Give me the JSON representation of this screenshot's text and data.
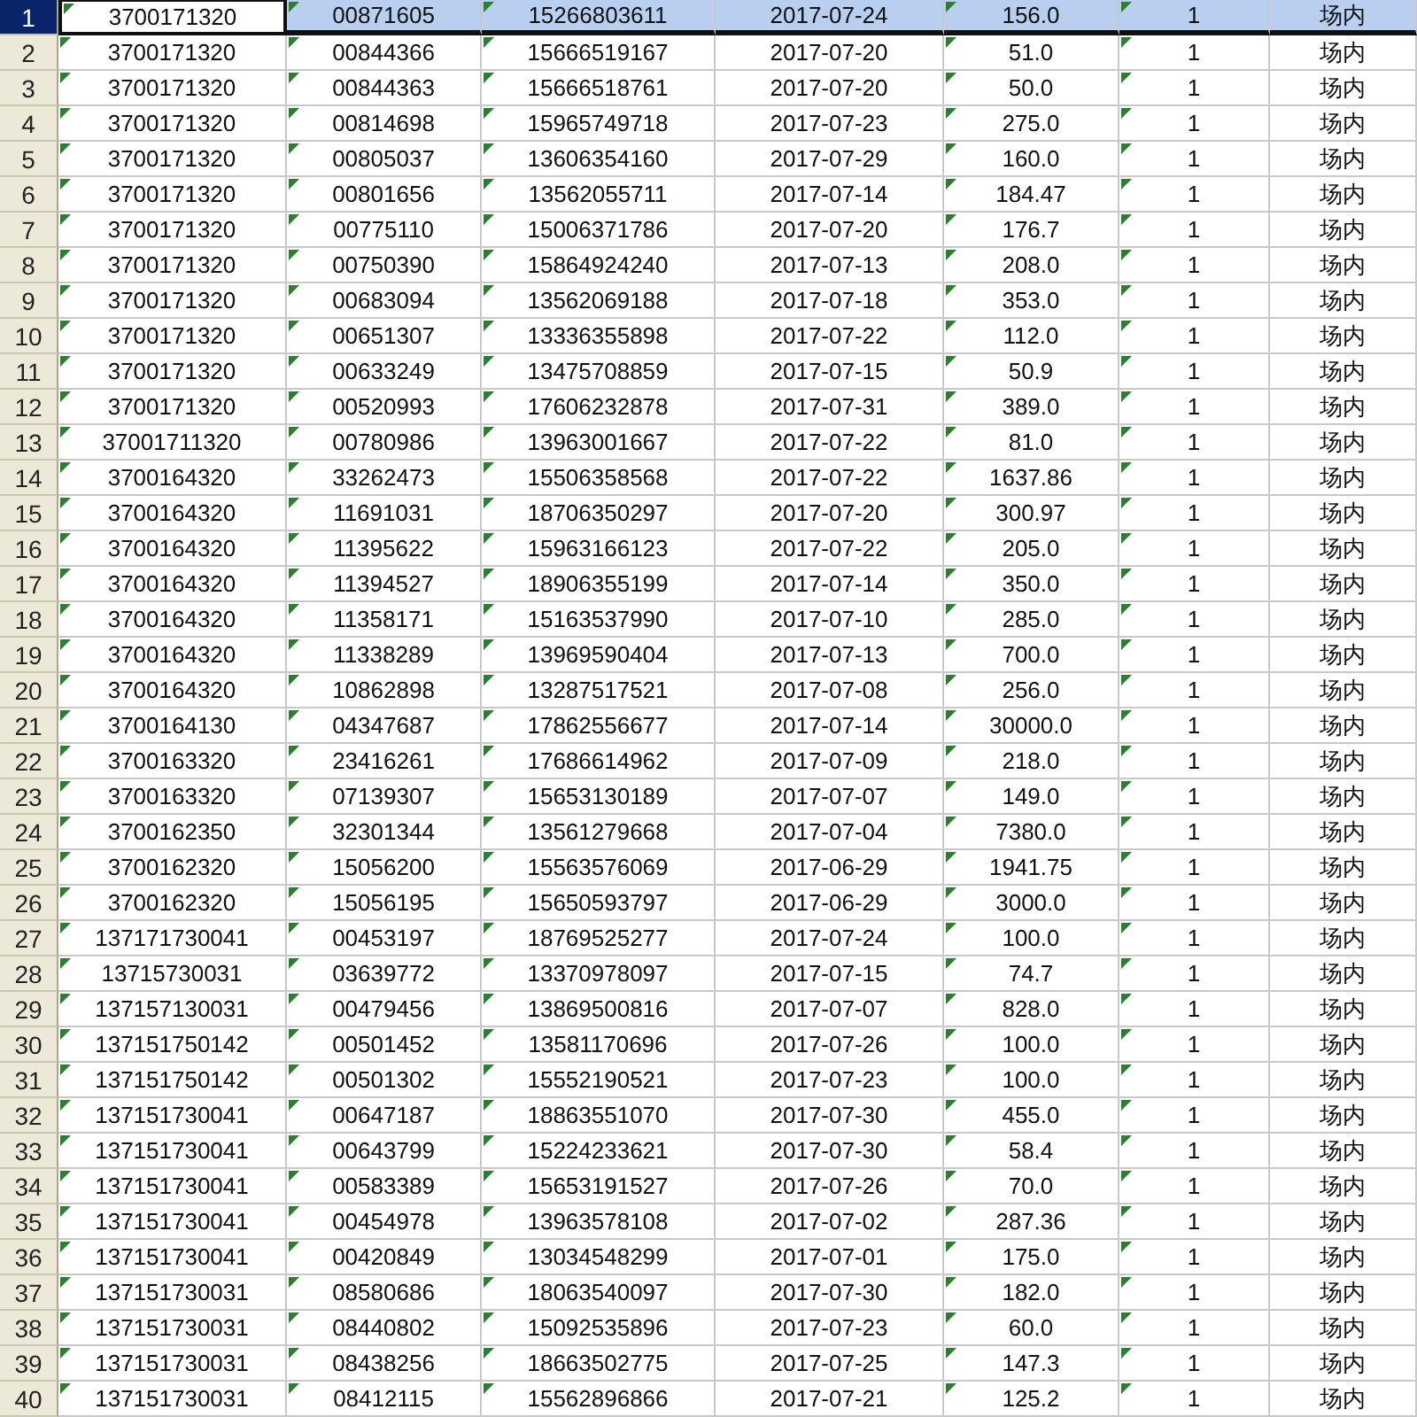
{
  "table": {
    "flagged_columns": [
      true,
      true,
      true,
      false,
      true,
      true,
      false
    ],
    "rows": [
      {
        "row": "1",
        "selected": true,
        "cells": [
          "3700171320",
          "00871605",
          "15266803611",
          "2017-07-24",
          "156.0",
          "1",
          "场内"
        ]
      },
      {
        "row": "2",
        "selected": false,
        "cells": [
          "3700171320",
          "00844366",
          "15666519167",
          "2017-07-20",
          "51.0",
          "1",
          "场内"
        ]
      },
      {
        "row": "3",
        "selected": false,
        "cells": [
          "3700171320",
          "00844363",
          "15666518761",
          "2017-07-20",
          "50.0",
          "1",
          "场内"
        ]
      },
      {
        "row": "4",
        "selected": false,
        "cells": [
          "3700171320",
          "00814698",
          "15965749718",
          "2017-07-23",
          "275.0",
          "1",
          "场内"
        ]
      },
      {
        "row": "5",
        "selected": false,
        "cells": [
          "3700171320",
          "00805037",
          "13606354160",
          "2017-07-29",
          "160.0",
          "1",
          "场内"
        ]
      },
      {
        "row": "6",
        "selected": false,
        "cells": [
          "3700171320",
          "00801656",
          "13562055711",
          "2017-07-14",
          "184.47",
          "1",
          "场内"
        ]
      },
      {
        "row": "7",
        "selected": false,
        "cells": [
          "3700171320",
          "00775110",
          "15006371786",
          "2017-07-20",
          "176.7",
          "1",
          "场内"
        ]
      },
      {
        "row": "8",
        "selected": false,
        "cells": [
          "3700171320",
          "00750390",
          "15864924240",
          "2017-07-13",
          "208.0",
          "1",
          "场内"
        ]
      },
      {
        "row": "9",
        "selected": false,
        "cells": [
          "3700171320",
          "00683094",
          "13562069188",
          "2017-07-18",
          "353.0",
          "1",
          "场内"
        ]
      },
      {
        "row": "10",
        "selected": false,
        "cells": [
          "3700171320",
          "00651307",
          "13336355898",
          "2017-07-22",
          "112.0",
          "1",
          "场内"
        ]
      },
      {
        "row": "11",
        "selected": false,
        "cells": [
          "3700171320",
          "00633249",
          "13475708859",
          "2017-07-15",
          "50.9",
          "1",
          "场内"
        ]
      },
      {
        "row": "12",
        "selected": false,
        "cells": [
          "3700171320",
          "00520993",
          "17606232878",
          "2017-07-31",
          "389.0",
          "1",
          "场内"
        ]
      },
      {
        "row": "13",
        "selected": false,
        "cells": [
          "37001711320",
          "00780986",
          "13963001667",
          "2017-07-22",
          "81.0",
          "1",
          "场内"
        ]
      },
      {
        "row": "14",
        "selected": false,
        "cells": [
          "3700164320",
          "33262473",
          "15506358568",
          "2017-07-22",
          "1637.86",
          "1",
          "场内"
        ]
      },
      {
        "row": "15",
        "selected": false,
        "cells": [
          "3700164320",
          "11691031",
          "18706350297",
          "2017-07-20",
          "300.97",
          "1",
          "场内"
        ]
      },
      {
        "row": "16",
        "selected": false,
        "cells": [
          "3700164320",
          "11395622",
          "15963166123",
          "2017-07-22",
          "205.0",
          "1",
          "场内"
        ]
      },
      {
        "row": "17",
        "selected": false,
        "cells": [
          "3700164320",
          "11394527",
          "18906355199",
          "2017-07-14",
          "350.0",
          "1",
          "场内"
        ]
      },
      {
        "row": "18",
        "selected": false,
        "cells": [
          "3700164320",
          "11358171",
          "15163537990",
          "2017-07-10",
          "285.0",
          "1",
          "场内"
        ]
      },
      {
        "row": "19",
        "selected": false,
        "cells": [
          "3700164320",
          "11338289",
          "13969590404",
          "2017-07-13",
          "700.0",
          "1",
          "场内"
        ]
      },
      {
        "row": "20",
        "selected": false,
        "cells": [
          "3700164320",
          "10862898",
          "13287517521",
          "2017-07-08",
          "256.0",
          "1",
          "场内"
        ]
      },
      {
        "row": "21",
        "selected": false,
        "cells": [
          "3700164130",
          "04347687",
          "17862556677",
          "2017-07-14",
          "30000.0",
          "1",
          "场内"
        ]
      },
      {
        "row": "22",
        "selected": false,
        "cells": [
          "3700163320",
          "23416261",
          "17686614962",
          "2017-07-09",
          "218.0",
          "1",
          "场内"
        ]
      },
      {
        "row": "23",
        "selected": false,
        "cells": [
          "3700163320",
          "07139307",
          "15653130189",
          "2017-07-07",
          "149.0",
          "1",
          "场内"
        ]
      },
      {
        "row": "24",
        "selected": false,
        "cells": [
          "3700162350",
          "32301344",
          "13561279668",
          "2017-07-04",
          "7380.0",
          "1",
          "场内"
        ]
      },
      {
        "row": "25",
        "selected": false,
        "cells": [
          "3700162320",
          "15056200",
          "15563576069",
          "2017-06-29",
          "1941.75",
          "1",
          "场内"
        ]
      },
      {
        "row": "26",
        "selected": false,
        "cells": [
          "3700162320",
          "15056195",
          "15650593797",
          "2017-06-29",
          "3000.0",
          "1",
          "场内"
        ]
      },
      {
        "row": "27",
        "selected": false,
        "cells": [
          "137171730041",
          "00453197",
          "18769525277",
          "2017-07-24",
          "100.0",
          "1",
          "场内"
        ]
      },
      {
        "row": "28",
        "selected": false,
        "cells": [
          "13715730031",
          "03639772",
          "13370978097",
          "2017-07-15",
          "74.7",
          "1",
          "场内"
        ]
      },
      {
        "row": "29",
        "selected": false,
        "cells": [
          "137157130031",
          "00479456",
          "13869500816",
          "2017-07-07",
          "828.0",
          "1",
          "场内"
        ]
      },
      {
        "row": "30",
        "selected": false,
        "cells": [
          "137151750142",
          "00501452",
          "13581170696",
          "2017-07-26",
          "100.0",
          "1",
          "场内"
        ]
      },
      {
        "row": "31",
        "selected": false,
        "cells": [
          "137151750142",
          "00501302",
          "15552190521",
          "2017-07-23",
          "100.0",
          "1",
          "场内"
        ]
      },
      {
        "row": "32",
        "selected": false,
        "cells": [
          "137151730041",
          "00647187",
          "18863551070",
          "2017-07-30",
          "455.0",
          "1",
          "场内"
        ]
      },
      {
        "row": "33",
        "selected": false,
        "cells": [
          "137151730041",
          "00643799",
          "15224233621",
          "2017-07-30",
          "58.4",
          "1",
          "场内"
        ]
      },
      {
        "row": "34",
        "selected": false,
        "cells": [
          "137151730041",
          "00583389",
          "15653191527",
          "2017-07-26",
          "70.0",
          "1",
          "场内"
        ]
      },
      {
        "row": "35",
        "selected": false,
        "cells": [
          "137151730041",
          "00454978",
          "13963578108",
          "2017-07-02",
          "287.36",
          "1",
          "场内"
        ]
      },
      {
        "row": "36",
        "selected": false,
        "cells": [
          "137151730041",
          "00420849",
          "13034548299",
          "2017-07-01",
          "175.0",
          "1",
          "场内"
        ]
      },
      {
        "row": "37",
        "selected": false,
        "cells": [
          "137151730031",
          "08580686",
          "18063540097",
          "2017-07-30",
          "182.0",
          "1",
          "场内"
        ]
      },
      {
        "row": "38",
        "selected": false,
        "cells": [
          "137151730031",
          "08440802",
          "15092535896",
          "2017-07-23",
          "60.0",
          "1",
          "场内"
        ]
      },
      {
        "row": "39",
        "selected": false,
        "cells": [
          "137151730031",
          "08438256",
          "18663502775",
          "2017-07-25",
          "147.3",
          "1",
          "场内"
        ]
      },
      {
        "row": "40",
        "selected": false,
        "cells": [
          "137151730031",
          "08412115",
          "15562896866",
          "2017-07-21",
          "125.2",
          "1",
          "场内"
        ]
      }
    ]
  }
}
